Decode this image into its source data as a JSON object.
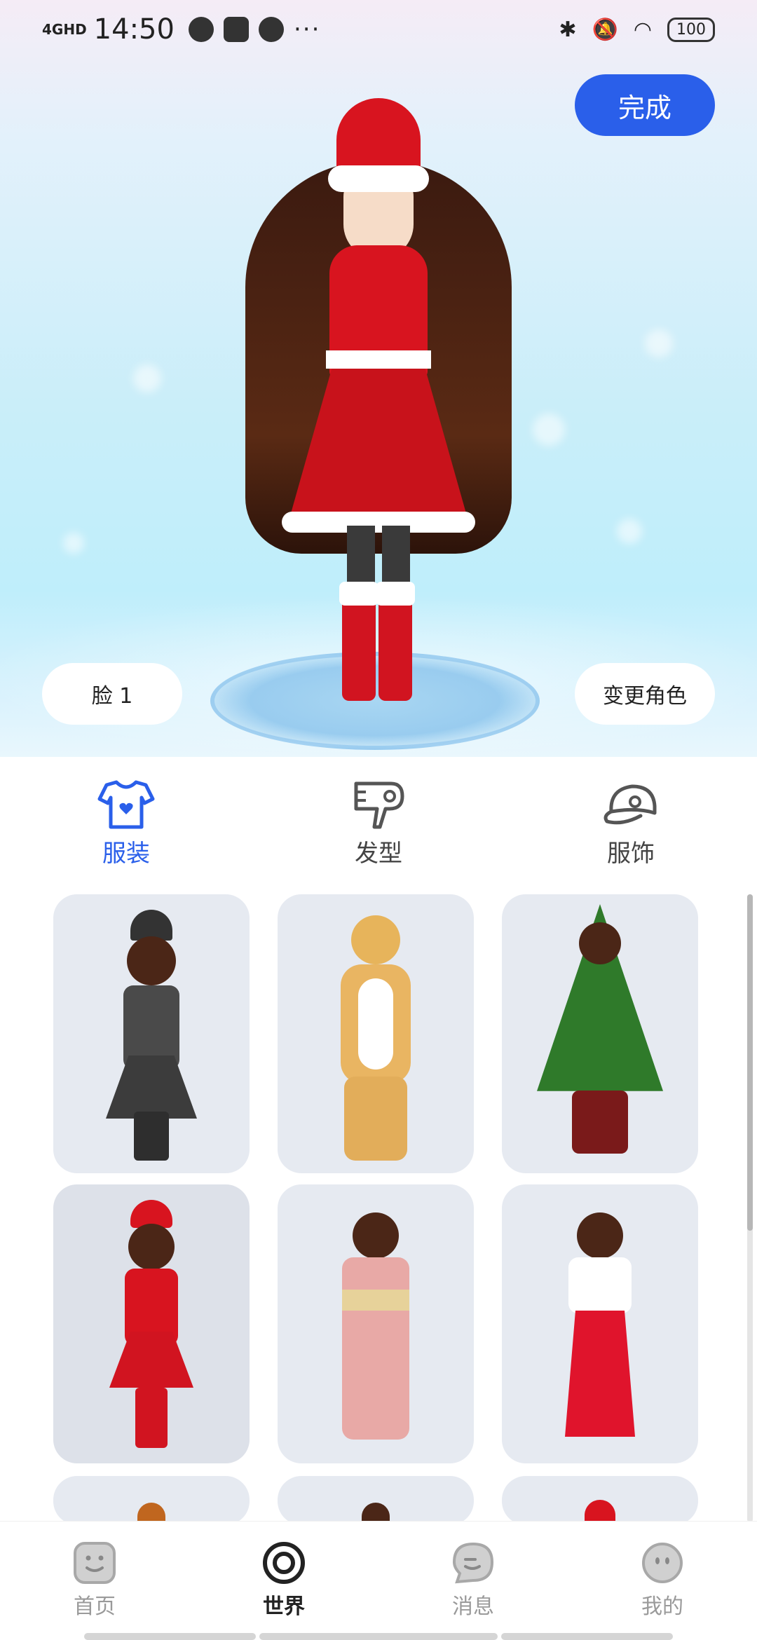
{
  "status_bar": {
    "network": "4GHD",
    "time": "14:50",
    "more": "···",
    "battery": "100"
  },
  "stage": {
    "done_label": "完成",
    "face_label": "脸 1",
    "change_role_label": "变更角色"
  },
  "tabs": [
    {
      "label": "服装",
      "icon": "tshirt-icon",
      "active": true
    },
    {
      "label": "发型",
      "icon": "hairdryer-icon",
      "active": false
    },
    {
      "label": "服饰",
      "icon": "cap-icon",
      "active": false
    }
  ],
  "outfits": [
    {
      "name": "witch-outfit",
      "selected": false
    },
    {
      "name": "reindeer-outfit",
      "selected": false
    },
    {
      "name": "christmas-tree-outfit",
      "selected": false
    },
    {
      "name": "santa-dress-outfit",
      "selected": true
    },
    {
      "name": "kimono-outfit",
      "selected": false
    },
    {
      "name": "shrine-maiden-outfit",
      "selected": false
    }
  ],
  "bottom_nav": [
    {
      "label": "首页",
      "icon": "home-face-icon",
      "active": false
    },
    {
      "label": "世界",
      "icon": "world-ring-icon",
      "active": true
    },
    {
      "label": "消息",
      "icon": "message-bubble-icon",
      "active": false
    },
    {
      "label": "我的",
      "icon": "profile-face-icon",
      "active": false
    }
  ],
  "colors": {
    "accent": "#2a5fea",
    "card_bg": "#e6eaf1"
  }
}
